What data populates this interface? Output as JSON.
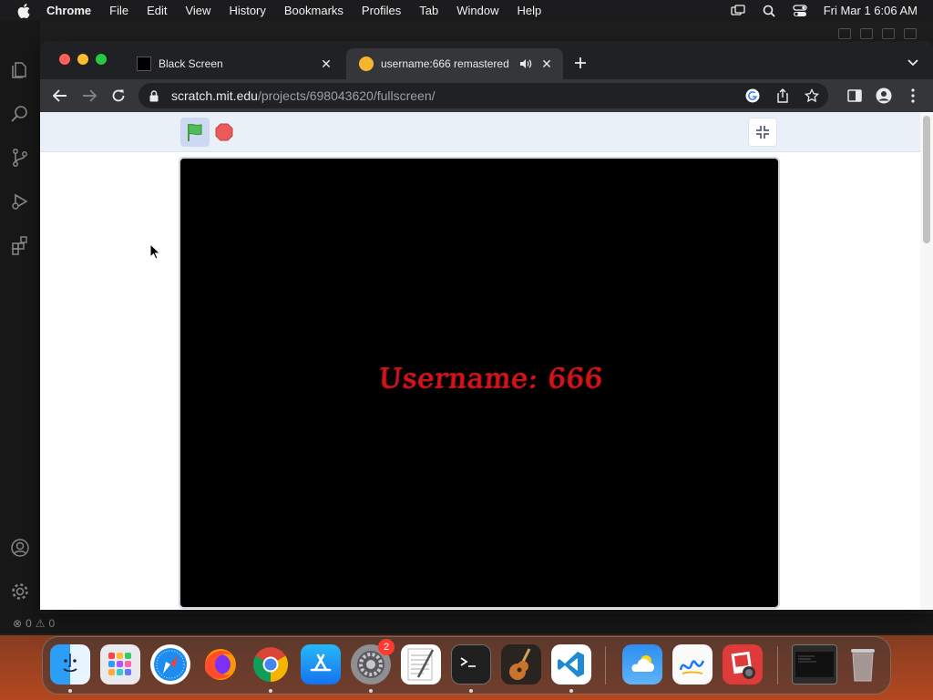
{
  "menubar": {
    "apple_icon": "apple-logo-icon",
    "items": [
      "Chrome",
      "File",
      "Edit",
      "View",
      "History",
      "Bookmarks",
      "Profiles",
      "Tab",
      "Window",
      "Help"
    ],
    "clock": "Fri Mar 1  6:06 AM",
    "status_icons": [
      "screen-mirroring-icon",
      "spotlight-search-icon",
      "control-center-icon"
    ]
  },
  "vscode": {
    "activity_icons": [
      "explorer-icon",
      "search-icon",
      "source-control-icon",
      "run-debug-icon",
      "extensions-icon",
      "account-icon",
      "manage-gear-icon"
    ],
    "status_errors": "0",
    "status_warnings": "0"
  },
  "chrome": {
    "tabs": [
      {
        "title": "Black Screen",
        "active": false
      },
      {
        "title": "username:666 remastered",
        "active": true,
        "audio_playing": true
      }
    ],
    "url_host": "scratch.mit.edu",
    "url_path": "/projects/698043620/fullscreen/"
  },
  "scratch": {
    "stage_text": "Username: 666",
    "stage_text_color": "#d3141b",
    "stage_background": "#000000"
  },
  "dock": {
    "apps": [
      "Finder",
      "Launchpad",
      "Safari",
      "Firefox",
      "Google Chrome",
      "App Store",
      "System Settings",
      "TextEdit",
      "Terminal",
      "GarageBand",
      "Visual Studio Code",
      "Weather",
      "Freeform",
      "Photo Booth",
      "Screenshot",
      "Trash"
    ],
    "system_settings_badge": "2"
  },
  "colors": {
    "chrome_dark": "#202124",
    "chrome_toolbar": "#35363a",
    "scratch_menu": "#e9f0f8"
  }
}
